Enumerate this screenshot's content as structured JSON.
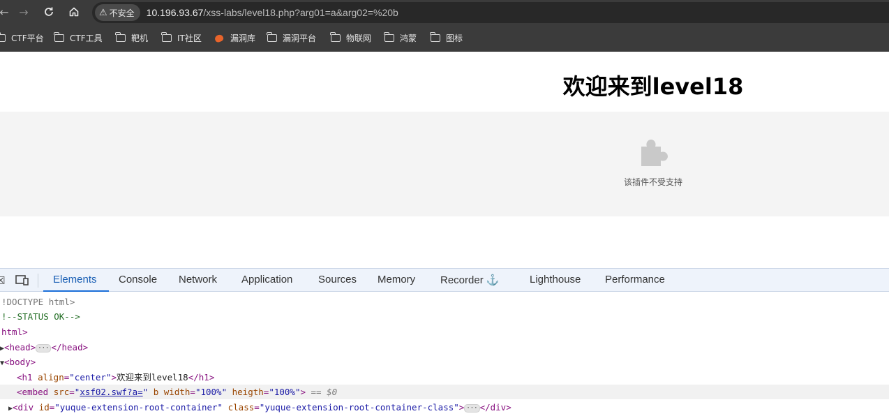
{
  "browser": {
    "security_label": "不安全",
    "url_host": "10.196.93.67",
    "url_path": "/xss-labs/level18.php?arg01=a&arg02=%20b"
  },
  "bookmarks": [
    {
      "label": "CTF平台",
      "icon": "folder-icon"
    },
    {
      "label": "CTF工具",
      "icon": "folder-icon"
    },
    {
      "label": "靶机",
      "icon": "folder-icon"
    },
    {
      "label": "IT社区",
      "icon": "folder-icon"
    },
    {
      "label": "漏洞库",
      "icon": "fire-icon"
    },
    {
      "label": "漏洞平台",
      "icon": "folder-icon"
    },
    {
      "label": "物联网",
      "icon": "folder-icon"
    },
    {
      "label": "鸿蒙",
      "icon": "folder-icon"
    },
    {
      "label": "图标",
      "icon": "folder-icon"
    }
  ],
  "page": {
    "title": "欢迎来到level18",
    "plugin_message": "该插件不受支持"
  },
  "devtools": {
    "tabs": [
      "Elements",
      "Console",
      "Network",
      "Application",
      "Sources",
      "Memory",
      "Recorder",
      "Lighthouse",
      "Performance"
    ],
    "active_tab": "Elements",
    "dom": {
      "doctype": "!DOCTYPE html>",
      "comment": "!--STATUS OK-->",
      "html_open": "html>",
      "head_open": "<head>",
      "head_ellipsis": "···",
      "head_close": "</head>",
      "body_open": "<body>",
      "h1_open": "<h1 ",
      "h1_attr": "align",
      "h1_attr_val": "\"center\"",
      "h1_text": "欢迎来到level18",
      "h1_close": "</h1>",
      "embed_open": "<embed ",
      "embed_src_attr": "src",
      "embed_src_val": "xsf02.swf?a=",
      "embed_src_quote": "\"",
      "embed_b": " b",
      "embed_width_attr": "width",
      "embed_width_val": "\"100%\"",
      "embed_heigth_attr": "heigth",
      "embed_heigth_val": "\"100%\"",
      "embed_close": ">",
      "embed_eq": " == $0",
      "div_open": "<div ",
      "div_id_attr": "id",
      "div_id_val": "\"yuque-extension-root-container\"",
      "div_class_attr": "class",
      "div_class_val": "\"yuque-extension-root-container-class\"",
      "div_close_bracket": ">",
      "div_ellipsis": "···",
      "div_close": "</div>"
    }
  }
}
